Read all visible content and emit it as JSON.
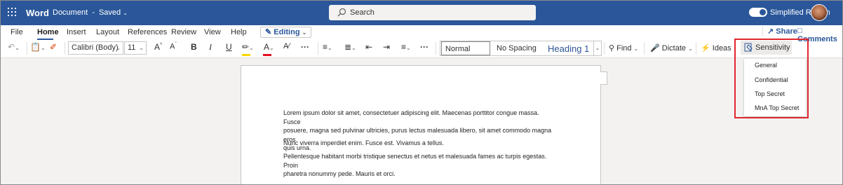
{
  "titlebar": {
    "app": "Word",
    "document": "Document",
    "saved": "Saved",
    "search_placeholder": "Search",
    "simplified_ribbon": "Simplified Ribbon"
  },
  "tabs": [
    "File",
    "Home",
    "Insert",
    "Layout",
    "References",
    "Review",
    "View",
    "Help"
  ],
  "editing_label": "Editing",
  "share_label": "Share",
  "comments_label": "Comments",
  "font": {
    "family": "Calibri (Body)",
    "size": "11"
  },
  "styles": {
    "normal": "Normal",
    "no_spacing": "No Spacing",
    "heading1": "Heading 1"
  },
  "tools": {
    "find": "Find",
    "dictate": "Dictate",
    "ideas": "Ideas",
    "sensitivity": "Sensitivity"
  },
  "sensitivity_menu": [
    "General",
    "Confidential",
    "Top Secret",
    "MnA Top Secret"
  ],
  "document": {
    "paragraphs": [
      [
        "Lorem ipsum dolor sit amet, consectetuer adipiscing elit. Maecenas porttitor congue massa. Fusce",
        "posuere, magna sed pulvinar ultricies, purus lectus malesuada libero, sit amet commodo magna eros",
        "quis urna."
      ],
      [
        "Nunc viverra imperdiet enim. Fusce est. Vivamus a tellus."
      ],
      [
        "Pellentesque habitant morbi tristique senectus et netus et malesuada fames ac turpis egestas. Proin",
        "pharetra nonummy pede. Mauris et orci."
      ]
    ]
  },
  "colors": {
    "brand": "#2b579a",
    "highlight": "#e0262e",
    "font_color_bar": "#e81123",
    "highlight_bar": "#ffd800"
  }
}
